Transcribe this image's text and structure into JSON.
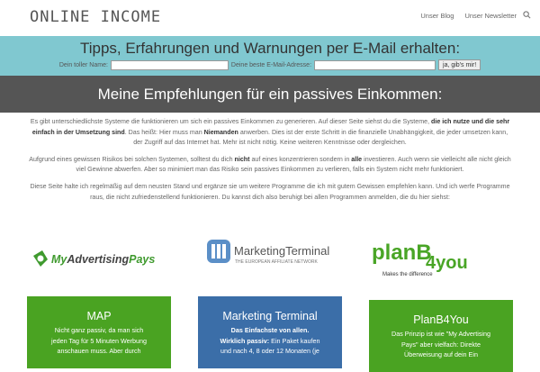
{
  "header": {
    "logo": "Online Income",
    "nav": [
      "Unser Blog",
      "Unser Newsletter"
    ]
  },
  "signup": {
    "title": "Tipps, Erfahrungen und Warnungen per E-Mail erhalten:",
    "name_label": "Dein toller Name:",
    "email_label": "Deine beste E-Mail-Adresse:",
    "submit": "ja, gib's mir!"
  },
  "banner": {
    "title": "Meine Empfehlungen für ein passives Einkommen:"
  },
  "content": {
    "p1a": "Es gibt unterschiedlichste Systeme die funktionieren um sich ein passives Einkommen zu generieren. Auf dieser Seite siehst du die Systeme, ",
    "p1b": "die ich nutze und die sehr einfach in der Umsetzung sind",
    "p1c": ". Das heißt: Hier muss man ",
    "p1d": "Niemanden",
    "p1e": " anwerben. Dies ist der erste Schritt in die finanzielle Unabhängigkeit, die jeder umsetzen kann, der Zugriff auf das Internet hat. Mehr ist nicht nötig. Keine weiteren Kenntnisse oder dergleichen.",
    "p2a": "Aufgrund eines gewissen Risikos bei solchen Systemen, solltest du dich ",
    "p2b": "nicht",
    "p2c": " auf eines konzentrieren sondern in ",
    "p2d": "alle",
    "p2e": " investieren. Auch wenn sie vielleicht alle nicht gleich viel Gewinne abwerfen. Aber so minimiert man das Risiko sein passives Einkommen zu verlieren, falls ein System nicht mehr funktioniert.",
    "p3": "Diese Seite halte ich regelmäßig auf dem neusten Stand und ergänze sie um weitere Programme die ich mit gutem Gewissen empfehlen kann. Und ich werfe Programme raus, die nicht zufriedenstellend funktionieren. Du kannst dich also beruhigt bei allen Programmen anmelden, die du hier siehst:"
  },
  "logos": {
    "l1": {
      "a": "My",
      "b": "Advertising",
      "c": "Pays"
    },
    "l2": {
      "title": "MarketingTerminal",
      "sub": "THE EUROPEAN AFFILIATE NETWORK"
    },
    "l3": {
      "a": "planB",
      "b": "4you",
      "c": "Makes the difference"
    }
  },
  "cards": [
    {
      "title": "MAP",
      "line1": "Nicht ganz passiv, da man sich jeden Tag für 5 Minuten Werbung anschauen muss. Aber durch"
    },
    {
      "title": "Marketing Terminal",
      "bold": "Das Einfachste von allen. Wirklich passiv:",
      "rest": " Ein Paket kaufen und nach 4, 8 oder 12 Monaten (je"
    },
    {
      "title": "PlanB4You",
      "line1": "Das Prinzip ist wie \"My Advertising Pays\" aber vielfach: Direkte Überweisung auf dein Ein"
    }
  ],
  "colors": {
    "signup_bg": "#80c8d0",
    "banner_bg": "#555555",
    "green": "#4aa322",
    "blue": "#3b6ea8"
  }
}
